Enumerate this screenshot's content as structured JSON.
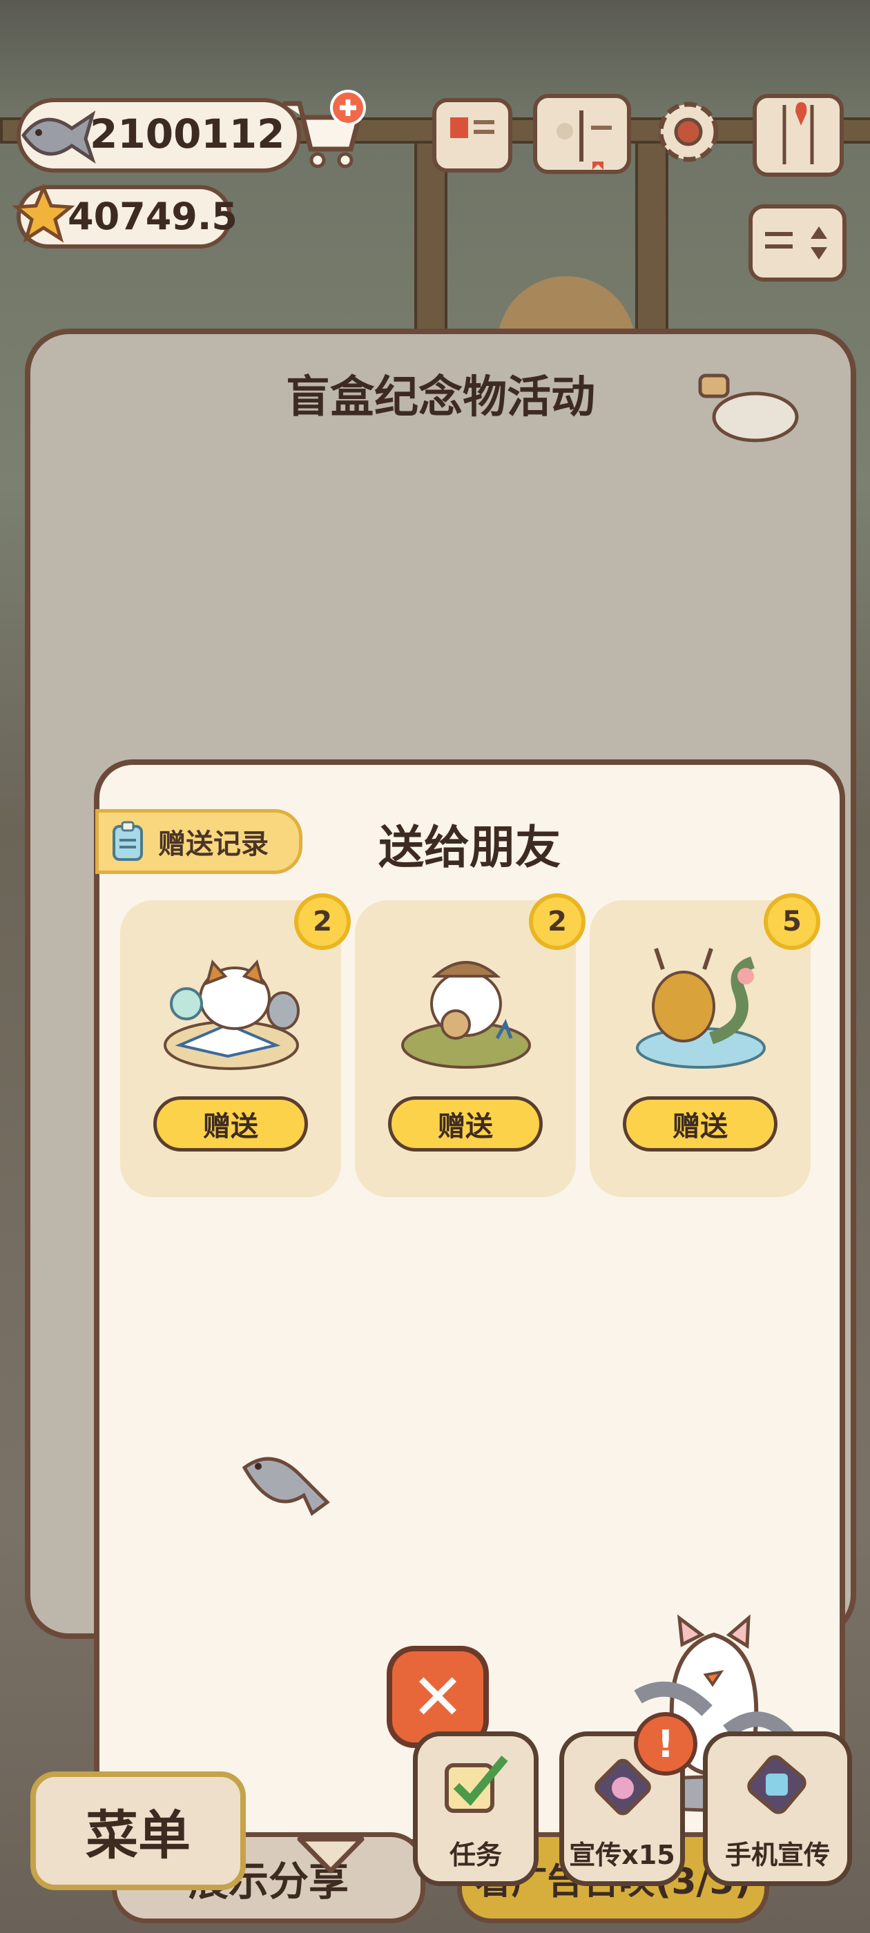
{
  "hud": {
    "fish_count": "2100112",
    "star_count": "40749.5"
  },
  "modal": {
    "title": "盲盒纪念物活动",
    "inner_title": "送给朋友",
    "history_label": "赠送记录",
    "items": [
      {
        "count": "2",
        "give_label": "赠送",
        "icon": "cat-scientist-figurine-icon"
      },
      {
        "count": "2",
        "give_label": "赠送",
        "icon": "cat-musician-figurine-icon"
      },
      {
        "count": "5",
        "give_label": "赠送",
        "icon": "dragon-figurine-icon"
      }
    ],
    "share_label": "展示分享",
    "ad_summon_label": "看广告召唤(3/3)"
  },
  "bottom_bar": {
    "menu_label": "菜单",
    "tasks_label": "任务",
    "promo_label": "宣传x15",
    "phone_promo_label": "手机宣传"
  },
  "colors": {
    "accent_yellow": "#fbd24a",
    "outline_brown": "#6b4a3a",
    "close_orange": "#e8673a"
  }
}
